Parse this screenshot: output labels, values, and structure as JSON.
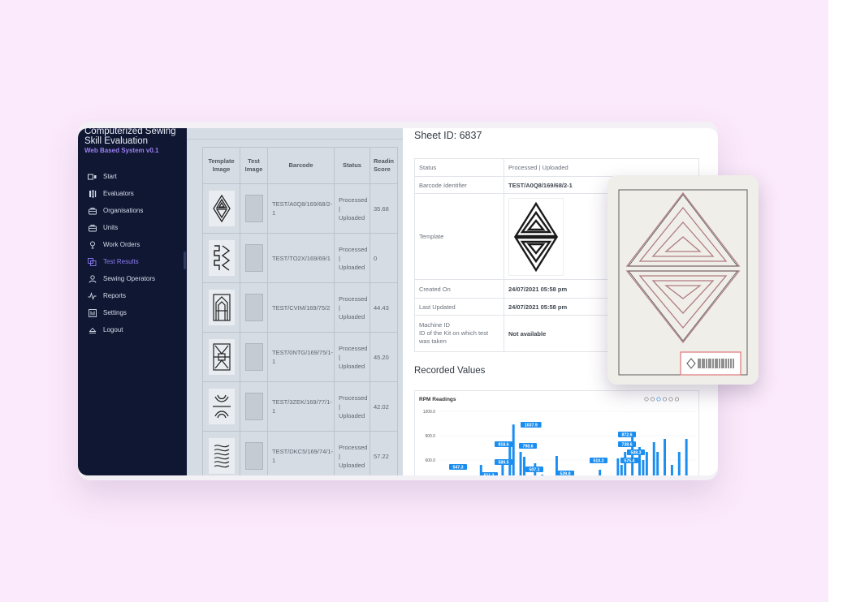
{
  "app": {
    "title": "Computerized Sewing Skill Evaluation",
    "subtitle": "Web Based System v0.1"
  },
  "sidebar": {
    "items": [
      {
        "label": "Start",
        "icon": "start-icon",
        "active": false
      },
      {
        "label": "Evaluators",
        "icon": "evaluators-icon",
        "active": false
      },
      {
        "label": "Organisations",
        "icon": "organisations-icon",
        "active": false
      },
      {
        "label": "Units",
        "icon": "units-icon",
        "active": false
      },
      {
        "label": "Work Orders",
        "icon": "work-orders-icon",
        "active": false
      },
      {
        "label": "Test Results",
        "icon": "test-results-icon",
        "active": true
      },
      {
        "label": "Sewing Operators",
        "icon": "sewing-operators-icon",
        "active": false
      },
      {
        "label": "Reports",
        "icon": "reports-icon",
        "active": false
      },
      {
        "label": "Settings",
        "icon": "settings-icon",
        "active": false
      },
      {
        "label": "Logout",
        "icon": "logout-icon",
        "active": false
      }
    ]
  },
  "table": {
    "top_strip_text": "...........",
    "headers": {
      "template_image": "Template Image",
      "test_image": "Test Image",
      "barcode": "Barcode",
      "status": "Status",
      "score": "Readin Score"
    },
    "rows": [
      {
        "barcode": "TEST/A0Q8/169/68/2-1",
        "status": "Processed | Uploaded",
        "score": "35.68"
      },
      {
        "barcode": "TEST/TO2X/169/69/1",
        "status": "Processed | Uploaded",
        "score": "0"
      },
      {
        "barcode": "TEST/CVIM/169/75/2",
        "status": "Processed | Uploaded",
        "score": "44.43"
      },
      {
        "barcode": "TEST/0NTG/169/75/1-1",
        "status": "Processed | Uploaded",
        "score": "45.20"
      },
      {
        "barcode": "TEST/3ZEK/169/77/1-1",
        "status": "Processed | Uploaded",
        "score": "42.02"
      },
      {
        "barcode": "TEST/DKC5/169/74/1-1",
        "status": "Processed | Uploaded",
        "score": "57.22"
      }
    ]
  },
  "detail": {
    "sheet_id": "Sheet ID: 6837",
    "fields": {
      "status_label": "Status",
      "status_value": "Processed | Uploaded",
      "barcode_label": "Barcode Identifier",
      "barcode_value": "TEST/A0Q8/169/68/2-1",
      "template_label": "Template",
      "created_label": "Created On",
      "created_value": "24/07/2021 05:58 pm",
      "updated_label": "Last Updated",
      "updated_value": "24/07/2021 05:58 pm",
      "machine_label_1": "Machine ID",
      "machine_label_2": "ID of the Kit on which test was taken",
      "machine_value": "Not available"
    },
    "recorded_values_title": "Recorded Values"
  },
  "chart_data": {
    "type": "bar",
    "title": "RPM Readings",
    "ylim": [
      0,
      1200
    ],
    "yticks": [
      "1200.0",
      "900.0",
      "600.0"
    ],
    "grid": true,
    "data_labels": [
      "1037.9",
      "818.6",
      "798.6",
      "589.5",
      "547.3",
      "511.3",
      "507.1",
      "510.3",
      "539.8",
      "872.6",
      "738.6",
      "575.4",
      "508.3"
    ],
    "toolbar_icons": [
      "zoom-in-icon",
      "zoom-out-icon",
      "zoom-icon",
      "pan-icon",
      "home-icon",
      "menu-icon"
    ],
    "bar_color": "#1a8ef0"
  }
}
